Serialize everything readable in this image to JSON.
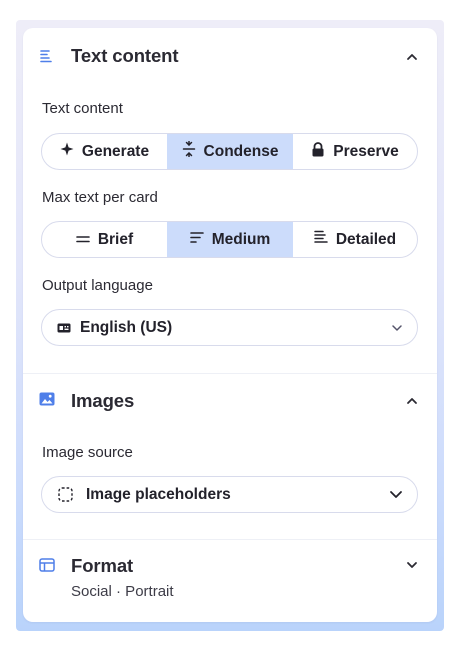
{
  "colors": {
    "accent": "#4f7fe9",
    "active_segment": "#ccdcfb",
    "border": "#d8dbec"
  },
  "text_section": {
    "title": "Text content",
    "mode_label": "Text content",
    "mode_options": [
      {
        "label": "Generate",
        "icon": "sparkle-icon",
        "selected": false
      },
      {
        "label": "Condense",
        "icon": "condense-icon",
        "selected": true
      },
      {
        "label": "Preserve",
        "icon": "lock-icon",
        "selected": false
      }
    ],
    "amount_label": "Max text per card",
    "amount_options": [
      {
        "label": "Brief",
        "icon": "brief-lines-icon",
        "selected": false
      },
      {
        "label": "Medium",
        "icon": "medium-lines-icon",
        "selected": true
      },
      {
        "label": "Detailed",
        "icon": "detailed-lines-icon",
        "selected": false
      }
    ],
    "language_label": "Output language",
    "language_value": "English (US)"
  },
  "images_section": {
    "title": "Images",
    "source_label": "Image source",
    "source_value": "Image placeholders"
  },
  "format_section": {
    "title": "Format",
    "subtitle": "Social · Portrait"
  }
}
